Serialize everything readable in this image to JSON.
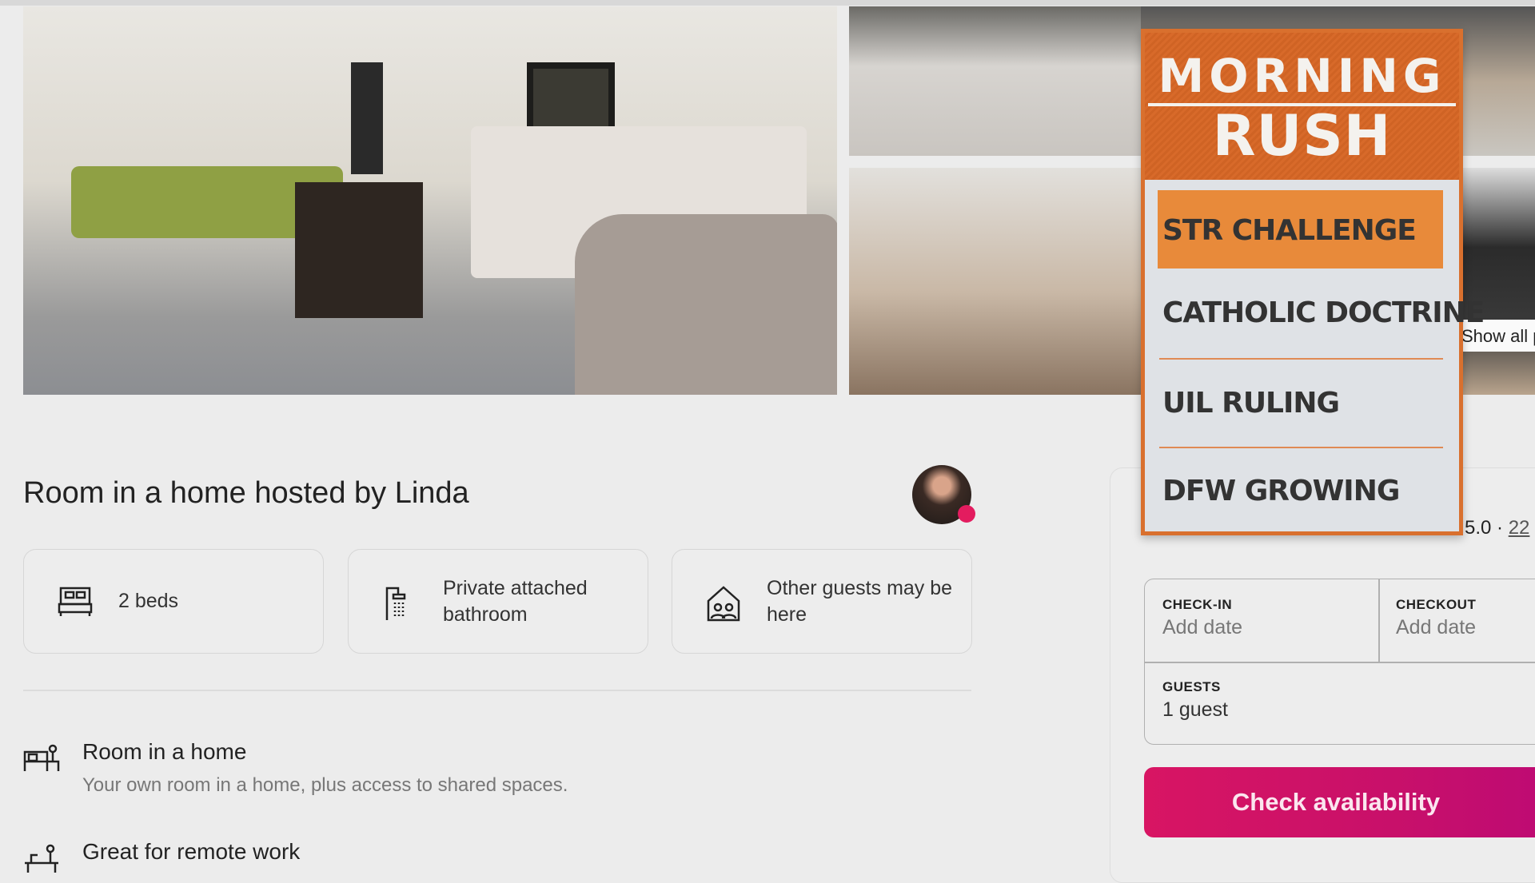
{
  "listing": {
    "title": "Room in a home hosted by Linda",
    "show_all_photos": "Show all photos",
    "highlights": [
      {
        "icon": "bed-icon",
        "label": "2 beds"
      },
      {
        "icon": "shower-icon",
        "label": "Private attached bathroom"
      },
      {
        "icon": "house-guests-icon",
        "label": "Other guests may be here"
      }
    ],
    "features": [
      {
        "icon": "room-icon",
        "title": "Room in a home",
        "description": "Your own room in a home, plus access to shared spaces."
      },
      {
        "icon": "desk-icon",
        "title": "Great for remote work",
        "description": ""
      }
    ]
  },
  "booking": {
    "rating": "5.0",
    "reviews": "22",
    "checkin_label": "CHECK-IN",
    "checkin_value": "Add date",
    "checkout_label": "CHECKOUT",
    "checkout_value": "Add date",
    "guests_label": "GUESTS",
    "guests_value": "1 guest",
    "cta": "Check availability",
    "cta_color": "#d81563"
  },
  "news_overlay": {
    "title_line1": "MORNING",
    "title_line2": "RUSH",
    "accent": "#d9702e",
    "items": [
      {
        "label": "STR CHALLENGE",
        "active": true
      },
      {
        "label": "CATHOLIC DOCTRINE",
        "active": false
      },
      {
        "label": "UIL RULING",
        "active": false
      },
      {
        "label": "DFW GROWING",
        "active": false
      }
    ]
  }
}
